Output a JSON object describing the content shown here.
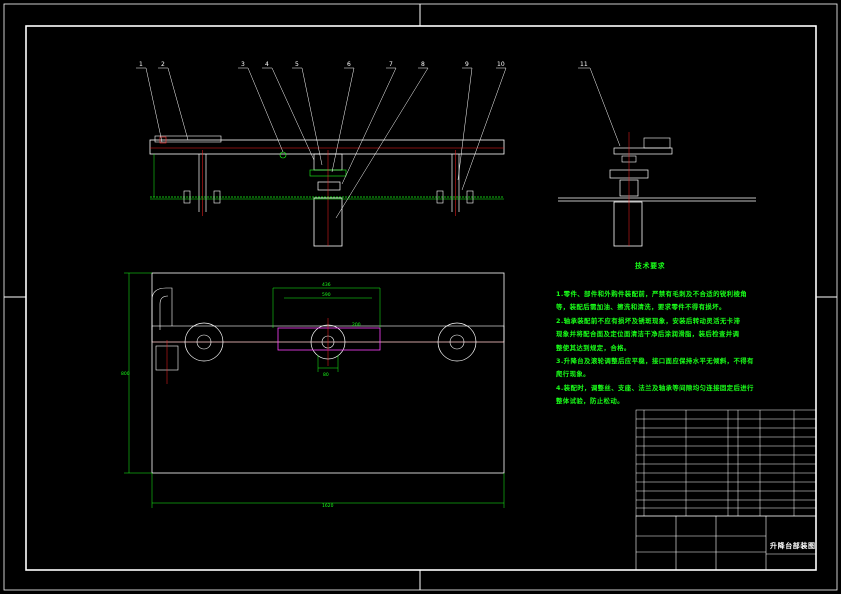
{
  "drawing": {
    "title": "升降台部装图",
    "colors": {
      "background": "#000000",
      "frame": "#ffffff",
      "outline": "#ffffff",
      "dimension": "#19ff19",
      "centerline": "#ff2020",
      "part": "#ff40ff",
      "accent": "#ff3030"
    }
  },
  "leader_labels": [
    "1",
    "2",
    "3",
    "4",
    "5",
    "6",
    "7",
    "8",
    "9",
    "10",
    "11"
  ],
  "technical_requirements": {
    "title": "技术要求",
    "items": [
      "1.零件、部件和外购件装配前，严禁有毛刺及不合适的锐利棱角",
      "等，装配后需加油、擦洗和清洗，要求零件不得有损坏。",
      "2.轴承装配前不应有损坏及锈斑现象，安装后转动灵活无卡滞",
      "现象并将配合面及定位面清洁干净后涂润滑脂，装后检查并调",
      "整使其达到规定，合格。",
      "3.升降台及滚轮调整后应平稳，接口面应保持水平无倾斜，不得有",
      "爬行现象。",
      "4.装配时，调整丝、支座、法兰及轴承等间隙均匀连接固定后进行",
      "整体试验，防止松动。"
    ]
  },
  "dimensions": {
    "overall_width": "1620",
    "overall_height": "800",
    "upper_span": "436",
    "plate_width": "590",
    "slot_width": "200",
    "gap": "80"
  }
}
